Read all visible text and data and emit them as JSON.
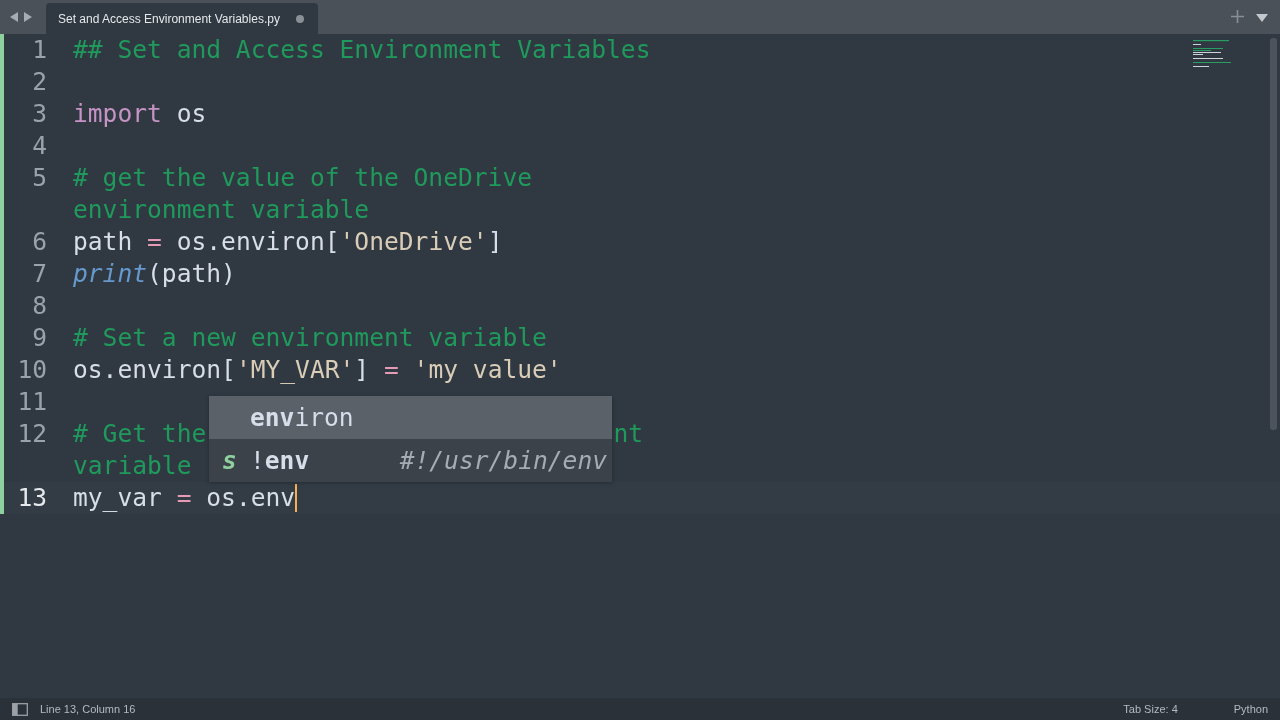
{
  "tab_bar": {
    "tabs": [
      {
        "title": "Set and Access Environment Variables.py",
        "selected": true,
        "modified": true
      }
    ]
  },
  "editor": {
    "lines": [
      {
        "number": "1",
        "changed": true,
        "selected": false,
        "rows": [
          [
            {
              "text": "## Set and Access Environment Variables",
              "kind": "comment"
            }
          ]
        ]
      },
      {
        "number": "2",
        "changed": true,
        "selected": false,
        "rows": [
          []
        ]
      },
      {
        "number": "3",
        "changed": true,
        "selected": false,
        "rows": [
          [
            {
              "text": "import",
              "kind": "keyword"
            },
            {
              "text": " os",
              "kind": "plain"
            }
          ]
        ]
      },
      {
        "number": "4",
        "changed": true,
        "selected": false,
        "rows": [
          []
        ]
      },
      {
        "number": "5",
        "changed": true,
        "selected": false,
        "rows": [
          [
            {
              "text": "# get the value of the OneDrive",
              "kind": "comment"
            }
          ],
          [
            {
              "text": "environment variable",
              "kind": "comment"
            }
          ]
        ]
      },
      {
        "number": "6",
        "changed": true,
        "selected": false,
        "rows": [
          [
            {
              "text": "path ",
              "kind": "plain"
            },
            {
              "text": "=",
              "kind": "operator"
            },
            {
              "text": " os.environ[",
              "kind": "plain"
            },
            {
              "text": "'OneDrive'",
              "kind": "string"
            },
            {
              "text": "]",
              "kind": "plain"
            }
          ]
        ]
      },
      {
        "number": "7",
        "changed": true,
        "selected": false,
        "rows": [
          [
            {
              "text": "print",
              "kind": "function"
            },
            {
              "text": "(path)",
              "kind": "plain"
            }
          ]
        ]
      },
      {
        "number": "8",
        "changed": true,
        "selected": false,
        "rows": [
          []
        ]
      },
      {
        "number": "9",
        "changed": true,
        "selected": false,
        "rows": [
          [
            {
              "text": "# Set a new environment variable",
              "kind": "comment"
            }
          ]
        ]
      },
      {
        "number": "10",
        "changed": true,
        "selected": false,
        "rows": [
          [
            {
              "text": "os.environ[",
              "kind": "plain"
            },
            {
              "text": "'MY_VAR'",
              "kind": "string"
            },
            {
              "text": "] ",
              "kind": "plain"
            },
            {
              "text": "=",
              "kind": "operator"
            },
            {
              "text": " ",
              "kind": "plain"
            },
            {
              "text": "'my value'",
              "kind": "string"
            }
          ]
        ]
      },
      {
        "number": "11",
        "changed": true,
        "selected": false,
        "rows": [
          []
        ]
      },
      {
        "number": "12",
        "changed": true,
        "selected": false,
        "rows": [
          [
            {
              "text": "# Get the",
              "kind": "comment"
            },
            {
              "text": "nt",
              "kind": "comment-tail"
            }
          ],
          [
            {
              "text": "variable",
              "kind": "comment"
            }
          ]
        ]
      },
      {
        "number": "13",
        "changed": true,
        "selected": true,
        "rows": [
          [
            {
              "text": "my_var ",
              "kind": "plain"
            },
            {
              "text": "=",
              "kind": "operator"
            },
            {
              "text": " os.env",
              "kind": "plain"
            }
          ]
        ]
      }
    ]
  },
  "autocomplete": {
    "items": [
      {
        "label": "**env**iron",
        "selected": true
      },
      {
        "kind_letter": "s",
        "label": "!**env**",
        "hint": "#!/usr/bin/env",
        "selected": false
      }
    ]
  },
  "status_bar": {
    "position": "Line 13, Column 16",
    "tab_size": "Tab Size: 4",
    "syntax": "Python"
  }
}
